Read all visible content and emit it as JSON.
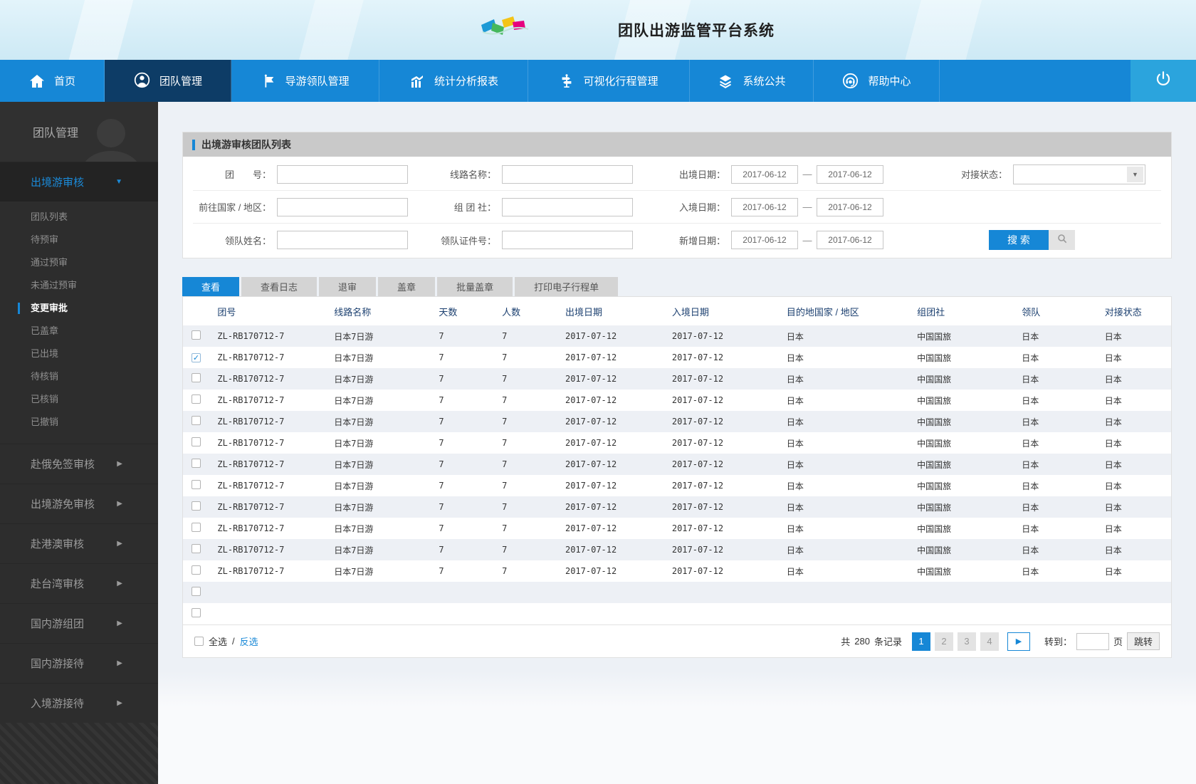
{
  "header": {
    "title": "团队出游监管平台系统"
  },
  "icons": {
    "dropdown": "▼",
    "expanded": "▼",
    "collapsed": "▶",
    "next": "▶",
    "check": "✓"
  },
  "nav": {
    "items": [
      {
        "key": "home",
        "icon": "home",
        "label": "首页",
        "active": false
      },
      {
        "key": "team",
        "icon": "team",
        "label": "团队管理",
        "active": true
      },
      {
        "key": "guide",
        "icon": "flag",
        "label": "导游领队管理",
        "active": false
      },
      {
        "key": "stats",
        "icon": "chart",
        "label": "统计分析报表",
        "active": false
      },
      {
        "key": "visual",
        "icon": "route",
        "label": "可视化行程管理",
        "active": false
      },
      {
        "key": "system",
        "icon": "layers",
        "label": "系统公共",
        "active": false
      },
      {
        "key": "help",
        "icon": "headset",
        "label": "帮助中心",
        "active": false
      }
    ]
  },
  "sidebar": {
    "title": "团队管理",
    "groups": [
      {
        "label": "出境游审核",
        "expanded": true,
        "items": [
          {
            "label": "团队列表",
            "active": false
          },
          {
            "label": "待预审",
            "active": false
          },
          {
            "label": "通过预审",
            "active": false
          },
          {
            "label": "未通过预审",
            "active": false
          },
          {
            "label": "变更审批",
            "active": true
          },
          {
            "label": "已盖章",
            "active": false
          },
          {
            "label": "已出境",
            "active": false
          },
          {
            "label": "待核销",
            "active": false
          },
          {
            "label": "已核销",
            "active": false
          },
          {
            "label": "已撤销",
            "active": false
          }
        ]
      },
      {
        "label": "赴俄免签审核",
        "expanded": false,
        "items": []
      },
      {
        "label": "出境游免审核",
        "expanded": false,
        "items": []
      },
      {
        "label": "赴港澳审核",
        "expanded": false,
        "items": []
      },
      {
        "label": "赴台湾审核",
        "expanded": false,
        "items": []
      },
      {
        "label": "国内游组团",
        "expanded": false,
        "items": []
      },
      {
        "label": "国内游接待",
        "expanded": false,
        "items": []
      },
      {
        "label": "入境游接待",
        "expanded": false,
        "items": []
      }
    ]
  },
  "panel": {
    "title": "出境游审核团队列表"
  },
  "form": {
    "group_no_label": "团　　号：",
    "route_label": "线路名称：",
    "depart_label": "出境日期：",
    "depart_from": "2017-06-12",
    "depart_to": "2017-06-12",
    "status_label": "对接状态：",
    "status_value": "",
    "country_label": "前往国家 / 地区：",
    "agency_label": "组 团 社：",
    "entry_label": "入境日期：",
    "entry_from": "2017-06-12",
    "entry_to": "2017-06-12",
    "leader_label": "领队姓名：",
    "leader_id_label": "领队证件号：",
    "added_label": "新增日期：",
    "added_from": "2017-06-12",
    "added_to": "2017-06-12",
    "dash": "—",
    "search_label": "搜 索"
  },
  "tabs": [
    {
      "label": "查看",
      "active": true
    },
    {
      "label": "查看日志",
      "active": false
    },
    {
      "label": "退审",
      "active": false
    },
    {
      "label": "盖章",
      "active": false
    },
    {
      "label": "批量盖章",
      "active": false
    },
    {
      "label": "打印电子行程单",
      "active": false
    }
  ],
  "table": {
    "columns": [
      "团号",
      "线路名称",
      "天数",
      "人数",
      "出境日期",
      "入境日期",
      "目的地国家 / 地区",
      "组团社",
      "领队",
      "对接状态"
    ],
    "rows": [
      {
        "checked": false,
        "cells": [
          "ZL-RB170712-7",
          "日本7日游",
          "7",
          "7",
          "2017-07-12",
          "2017-07-12",
          "日本",
          "中国国旅",
          "日本",
          "日本"
        ]
      },
      {
        "checked": true,
        "cells": [
          "ZL-RB170712-7",
          "日本7日游",
          "7",
          "7",
          "2017-07-12",
          "2017-07-12",
          "日本",
          "中国国旅",
          "日本",
          "日本"
        ]
      },
      {
        "checked": false,
        "cells": [
          "ZL-RB170712-7",
          "日本7日游",
          "7",
          "7",
          "2017-07-12",
          "2017-07-12",
          "日本",
          "中国国旅",
          "日本",
          "日本"
        ]
      },
      {
        "checked": false,
        "cells": [
          "ZL-RB170712-7",
          "日本7日游",
          "7",
          "7",
          "2017-07-12",
          "2017-07-12",
          "日本",
          "中国国旅",
          "日本",
          "日本"
        ]
      },
      {
        "checked": false,
        "cells": [
          "ZL-RB170712-7",
          "日本7日游",
          "7",
          "7",
          "2017-07-12",
          "2017-07-12",
          "日本",
          "中国国旅",
          "日本",
          "日本"
        ]
      },
      {
        "checked": false,
        "cells": [
          "ZL-RB170712-7",
          "日本7日游",
          "7",
          "7",
          "2017-07-12",
          "2017-07-12",
          "日本",
          "中国国旅",
          "日本",
          "日本"
        ]
      },
      {
        "checked": false,
        "cells": [
          "ZL-RB170712-7",
          "日本7日游",
          "7",
          "7",
          "2017-07-12",
          "2017-07-12",
          "日本",
          "中国国旅",
          "日本",
          "日本"
        ]
      },
      {
        "checked": false,
        "cells": [
          "ZL-RB170712-7",
          "日本7日游",
          "7",
          "7",
          "2017-07-12",
          "2017-07-12",
          "日本",
          "中国国旅",
          "日本",
          "日本"
        ]
      },
      {
        "checked": false,
        "cells": [
          "ZL-RB170712-7",
          "日本7日游",
          "7",
          "7",
          "2017-07-12",
          "2017-07-12",
          "日本",
          "中国国旅",
          "日本",
          "日本"
        ]
      },
      {
        "checked": false,
        "cells": [
          "ZL-RB170712-7",
          "日本7日游",
          "7",
          "7",
          "2017-07-12",
          "2017-07-12",
          "日本",
          "中国国旅",
          "日本",
          "日本"
        ]
      },
      {
        "checked": false,
        "cells": [
          "ZL-RB170712-7",
          "日本7日游",
          "7",
          "7",
          "2017-07-12",
          "2017-07-12",
          "日本",
          "中国国旅",
          "日本",
          "日本"
        ]
      },
      {
        "checked": false,
        "cells": [
          "ZL-RB170712-7",
          "日本7日游",
          "7",
          "7",
          "2017-07-12",
          "2017-07-12",
          "日本",
          "中国国旅",
          "日本",
          "日本"
        ]
      }
    ],
    "empty_rows": 2
  },
  "footer": {
    "select_all": "全选",
    "divider": "/",
    "invert": "反选",
    "total_prefix": "共",
    "total_count": "280",
    "total_suffix": "条记录",
    "pages": [
      "1",
      "2",
      "3",
      "4"
    ],
    "active_page": "1",
    "goto_label": "转到：",
    "page_word": "页",
    "jump_label": "跳转"
  },
  "colors": {
    "primary": "#1687d6",
    "nav_active": "#0d3c66",
    "power_bg": "#2ba4dd",
    "sidebar_bg": "#2d2d2d",
    "row_stripe": "#edf0f5",
    "panel_head_bg": "#c9c9c9"
  }
}
